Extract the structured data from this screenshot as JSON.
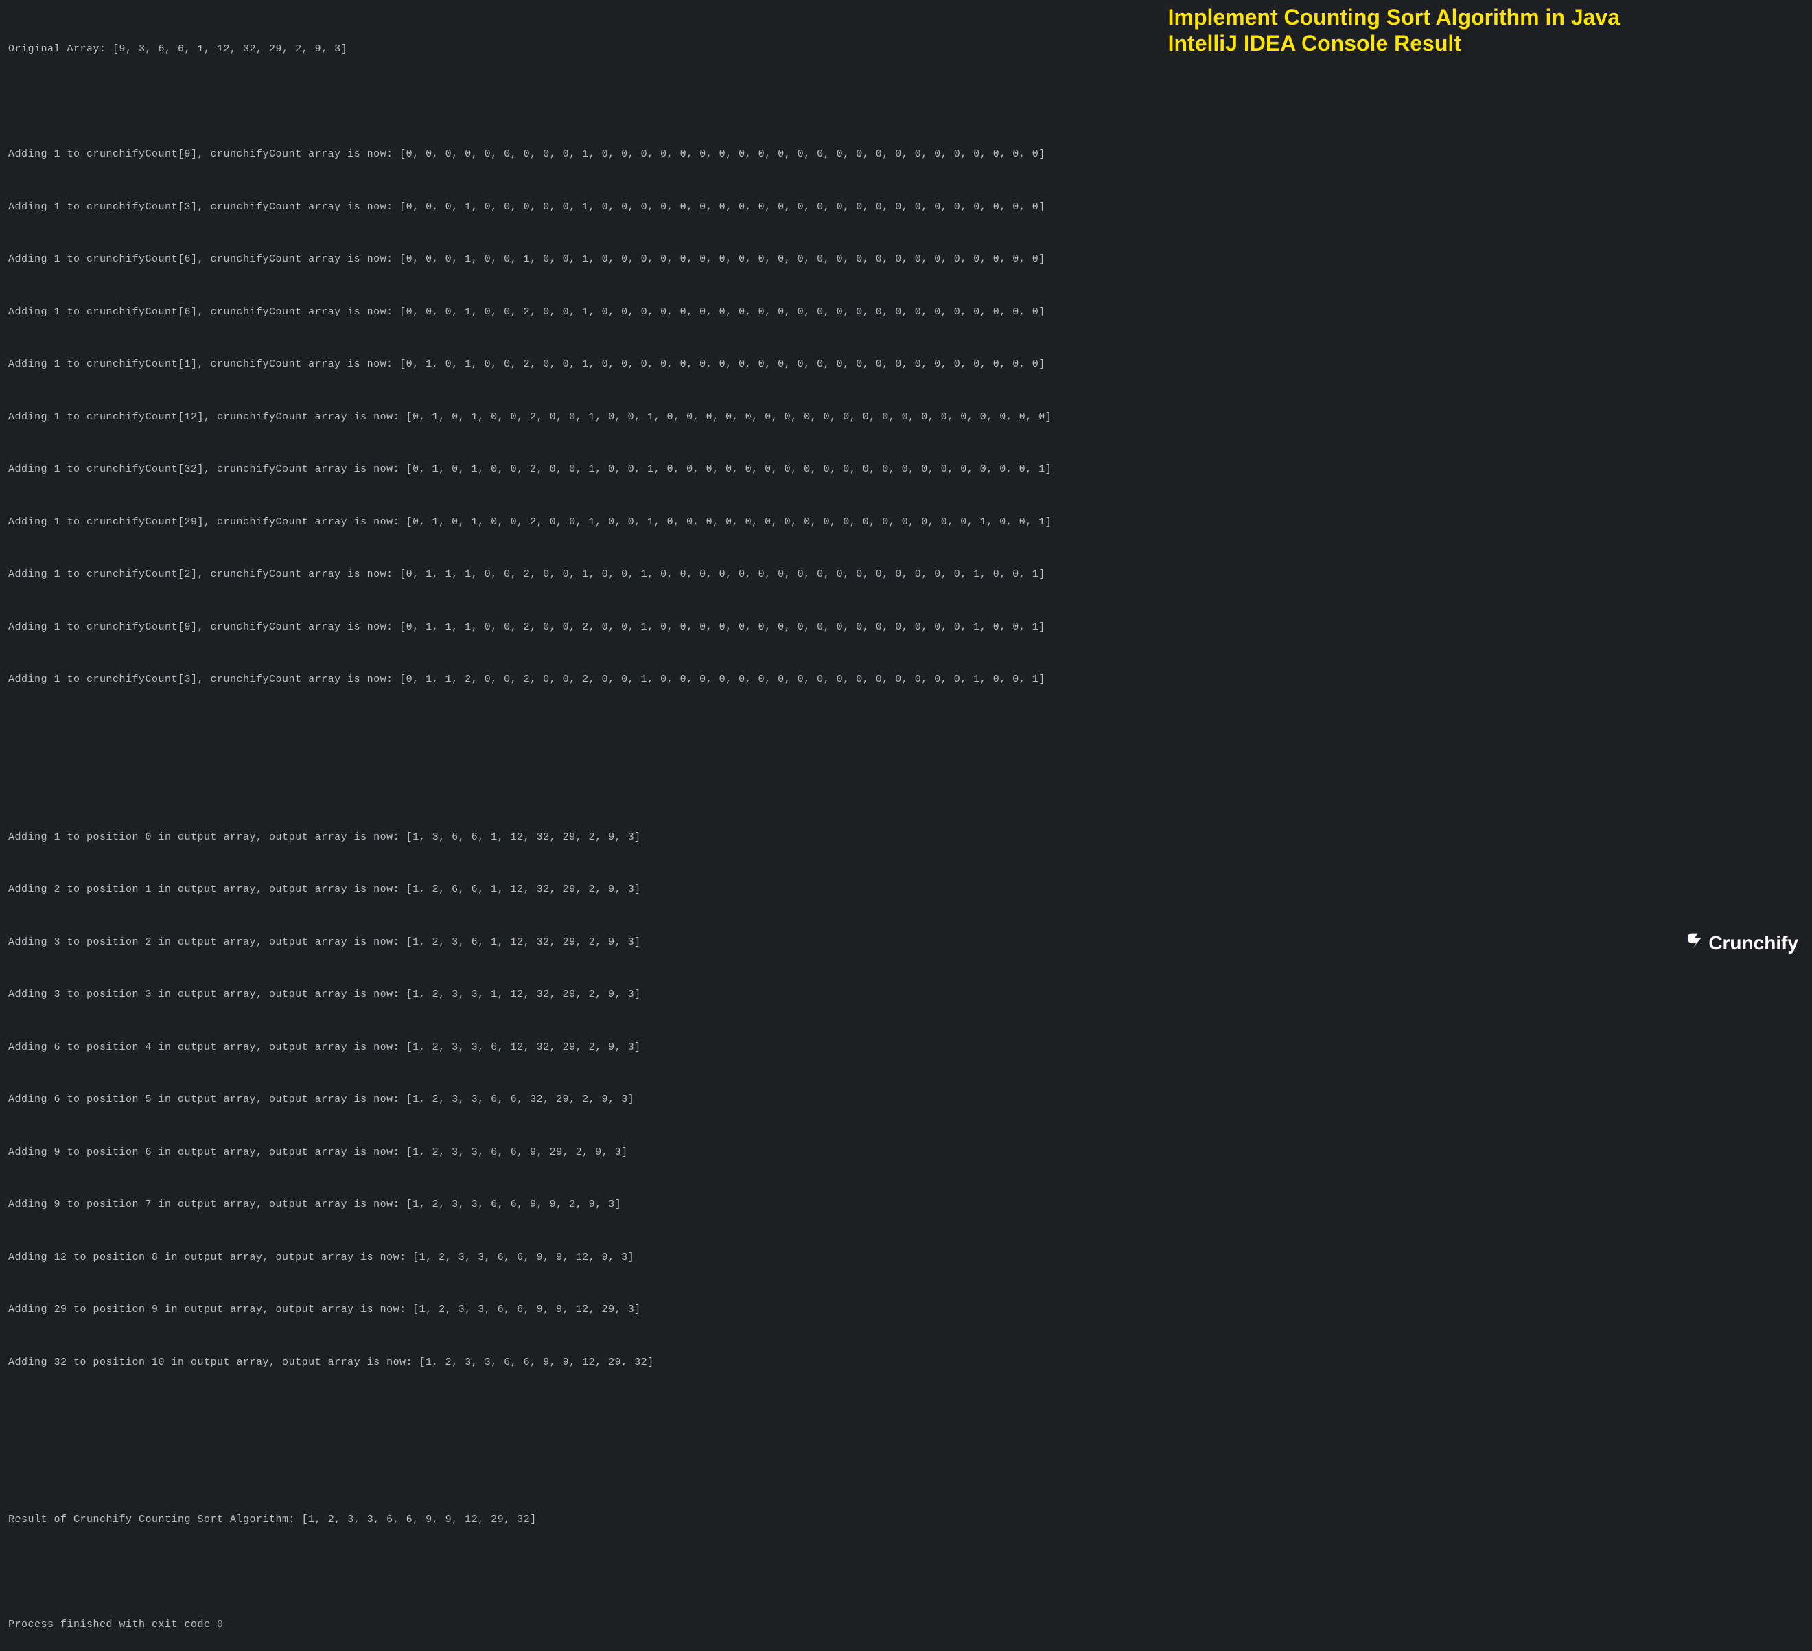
{
  "overlay": {
    "line1": "Implement Counting Sort Algorithm in Java",
    "line2": "IntelliJ IDEA Console Result"
  },
  "logo": {
    "text": "Crunchify"
  },
  "console": {
    "original_array": "Original Array: [9, 3, 6, 6, 1, 12, 32, 29, 2, 9, 3]",
    "count_steps": [
      "Adding 1 to crunchifyCount[9], crunchifyCount array is now: [0, 0, 0, 0, 0, 0, 0, 0, 0, 1, 0, 0, 0, 0, 0, 0, 0, 0, 0, 0, 0, 0, 0, 0, 0, 0, 0, 0, 0, 0, 0, 0, 0]",
      "Adding 1 to crunchifyCount[3], crunchifyCount array is now: [0, 0, 0, 1, 0, 0, 0, 0, 0, 1, 0, 0, 0, 0, 0, 0, 0, 0, 0, 0, 0, 0, 0, 0, 0, 0, 0, 0, 0, 0, 0, 0, 0]",
      "Adding 1 to crunchifyCount[6], crunchifyCount array is now: [0, 0, 0, 1, 0, 0, 1, 0, 0, 1, 0, 0, 0, 0, 0, 0, 0, 0, 0, 0, 0, 0, 0, 0, 0, 0, 0, 0, 0, 0, 0, 0, 0]",
      "Adding 1 to crunchifyCount[6], crunchifyCount array is now: [0, 0, 0, 1, 0, 0, 2, 0, 0, 1, 0, 0, 0, 0, 0, 0, 0, 0, 0, 0, 0, 0, 0, 0, 0, 0, 0, 0, 0, 0, 0, 0, 0]",
      "Adding 1 to crunchifyCount[1], crunchifyCount array is now: [0, 1, 0, 1, 0, 0, 2, 0, 0, 1, 0, 0, 0, 0, 0, 0, 0, 0, 0, 0, 0, 0, 0, 0, 0, 0, 0, 0, 0, 0, 0, 0, 0]",
      "Adding 1 to crunchifyCount[12], crunchifyCount array is now: [0, 1, 0, 1, 0, 0, 2, 0, 0, 1, 0, 0, 1, 0, 0, 0, 0, 0, 0, 0, 0, 0, 0, 0, 0, 0, 0, 0, 0, 0, 0, 0, 0]",
      "Adding 1 to crunchifyCount[32], crunchifyCount array is now: [0, 1, 0, 1, 0, 0, 2, 0, 0, 1, 0, 0, 1, 0, 0, 0, 0, 0, 0, 0, 0, 0, 0, 0, 0, 0, 0, 0, 0, 0, 0, 0, 1]",
      "Adding 1 to crunchifyCount[29], crunchifyCount array is now: [0, 1, 0, 1, 0, 0, 2, 0, 0, 1, 0, 0, 1, 0, 0, 0, 0, 0, 0, 0, 0, 0, 0, 0, 0, 0, 0, 0, 0, 1, 0, 0, 1]",
      "Adding 1 to crunchifyCount[2], crunchifyCount array is now: [0, 1, 1, 1, 0, 0, 2, 0, 0, 1, 0, 0, 1, 0, 0, 0, 0, 0, 0, 0, 0, 0, 0, 0, 0, 0, 0, 0, 0, 1, 0, 0, 1]",
      "Adding 1 to crunchifyCount[9], crunchifyCount array is now: [0, 1, 1, 1, 0, 0, 2, 0, 0, 2, 0, 0, 1, 0, 0, 0, 0, 0, 0, 0, 0, 0, 0, 0, 0, 0, 0, 0, 0, 1, 0, 0, 1]",
      "Adding 1 to crunchifyCount[3], crunchifyCount array is now: [0, 1, 1, 2, 0, 0, 2, 0, 0, 2, 0, 0, 1, 0, 0, 0, 0, 0, 0, 0, 0, 0, 0, 0, 0, 0, 0, 0, 0, 1, 0, 0, 1]"
    ],
    "output_steps": [
      "Adding 1 to position 0 in output array, output array is now: [1, 3, 6, 6, 1, 12, 32, 29, 2, 9, 3]",
      "Adding 2 to position 1 in output array, output array is now: [1, 2, 6, 6, 1, 12, 32, 29, 2, 9, 3]",
      "Adding 3 to position 2 in output array, output array is now: [1, 2, 3, 6, 1, 12, 32, 29, 2, 9, 3]",
      "Adding 3 to position 3 in output array, output array is now: [1, 2, 3, 3, 1, 12, 32, 29, 2, 9, 3]",
      "Adding 6 to position 4 in output array, output array is now: [1, 2, 3, 3, 6, 12, 32, 29, 2, 9, 3]",
      "Adding 6 to position 5 in output array, output array is now: [1, 2, 3, 3, 6, 6, 32, 29, 2, 9, 3]",
      "Adding 9 to position 6 in output array, output array is now: [1, 2, 3, 3, 6, 6, 9, 29, 2, 9, 3]",
      "Adding 9 to position 7 in output array, output array is now: [1, 2, 3, 3, 6, 6, 9, 9, 2, 9, 3]",
      "Adding 12 to position 8 in output array, output array is now: [1, 2, 3, 3, 6, 6, 9, 9, 12, 9, 3]",
      "Adding 29 to position 9 in output array, output array is now: [1, 2, 3, 3, 6, 6, 9, 9, 12, 29, 3]",
      "Adding 32 to position 10 in output array, output array is now: [1, 2, 3, 3, 6, 6, 9, 9, 12, 29, 32]"
    ],
    "result_line": "Result of Crunchify Counting Sort Algorithm: [1, 2, 3, 3, 6, 6, 9, 9, 12, 29, 32]",
    "exit_line": "Process finished with exit code 0"
  }
}
